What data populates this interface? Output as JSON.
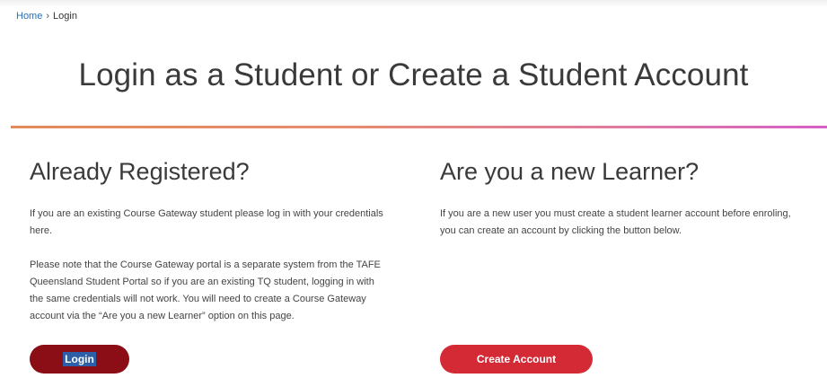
{
  "breadcrumb": {
    "home": "Home",
    "separator": "›",
    "current": "Login"
  },
  "page_title": "Login as a Student or Create a Student Account",
  "registered": {
    "heading": "Already Registered?",
    "para1": "If you are an existing Course Gateway student please log in with your credentials here.",
    "para2": "Please note that the Course Gateway portal is a separate system from the TAFE Queensland Student Portal so if you are an existing TQ student, logging in with the same credentials will not work. You will need to create a Course Gateway account via the “Are you a new Learner” option on this page.",
    "button_label": "Login"
  },
  "new_learner": {
    "heading": "Are you a new Learner?",
    "para1": "If you are a new user you must create a student learner account before enroling, you can create an account by clicking the button below.",
    "button_label": "Create Account"
  },
  "colors": {
    "login_button": "#8b0e17",
    "create_button": "#d32a36",
    "link": "#2a6fb3",
    "divider_start": "#e48b5b",
    "divider_end": "#d65fc8"
  }
}
